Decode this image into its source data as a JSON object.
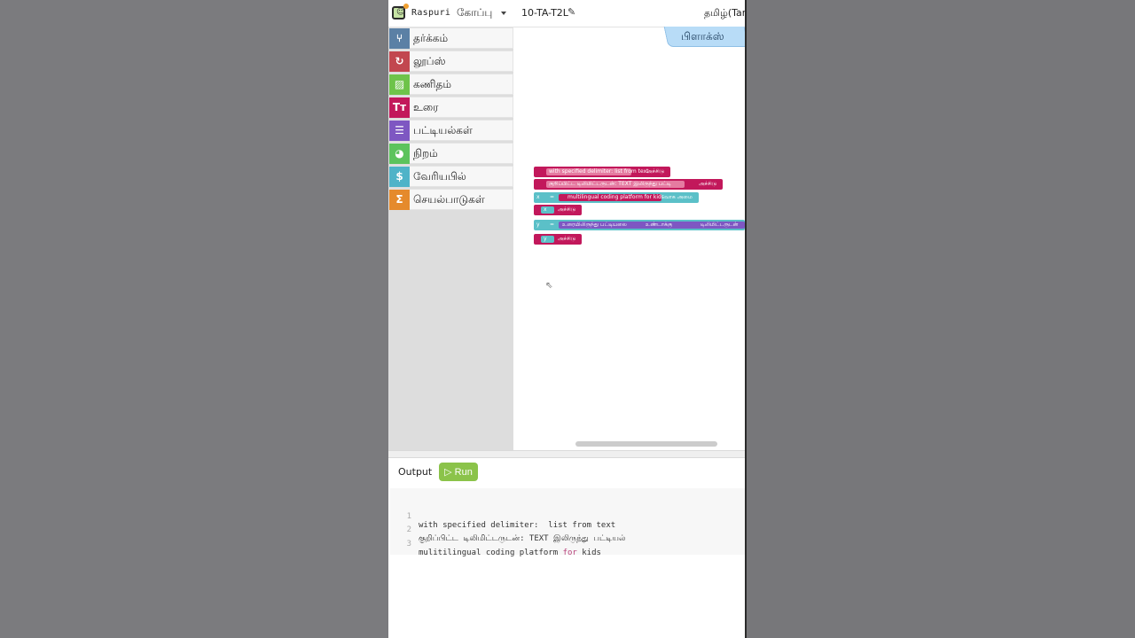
{
  "header": {
    "brand": "Raspuri",
    "menu_code": "கோப்பு",
    "project_name": "10-TA-T2L",
    "language": "தமிழ்(Tam"
  },
  "toolbox": {
    "categories": [
      {
        "label": "தர்க்கம்",
        "icon": "logic-icon",
        "color": "#5b80a5"
      },
      {
        "label": "லூப்ஸ்",
        "icon": "loop-icon",
        "color": "#c2474f"
      },
      {
        "label": "கணிதம்",
        "icon": "math-icon",
        "color": "#6ec34a"
      },
      {
        "label": "உரை",
        "icon": "text-icon",
        "color": "#c2185b"
      },
      {
        "label": "பட்டியல்கள்",
        "icon": "list-icon",
        "color": "#7e57c2"
      },
      {
        "label": "நிறம்",
        "icon": "palette-icon",
        "color": "#5cc35c"
      },
      {
        "label": "வேரியபில்",
        "icon": "variable-icon",
        "color": "#4fb3c8"
      },
      {
        "label": "செயல்பாடுகள்",
        "icon": "function-icon",
        "color": "#e58a2c"
      }
    ]
  },
  "workspace": {
    "flyout_label": "பிளாக்ஸ்",
    "blocks": {
      "b1_text": "with specified delimiter:  list from text",
      "b1_tail": "அச்சிடு",
      "b2_text": "குறிப்பிட்ட டிலிமிட்டருடன்: TEXT இலிருந்து பட்டி",
      "b2_tail": "அச்சிடு",
      "b3_var": "x",
      "b3_eq": "=",
      "b3_text": "multilingual coding platform for kids",
      "b3_tail": "வாக அமை",
      "b4_var": "x",
      "b4_tail": "அச்சிடு",
      "b5_var": "y",
      "b5_eq": "=",
      "b5_text": "உரையிலிருந்து பட்டியலை",
      "b5_mid": "உண்டாக்கு",
      "b5_tail": "டிலிமிட்டருடன்",
      "b6_var": "y",
      "b6_tail": "அச்சிடு"
    }
  },
  "output": {
    "label": "Output",
    "run_label": "▷ Run",
    "lines": [
      {
        "num": "1",
        "pre": "with specified delimiter:  list from text",
        "kw": "",
        "post": ""
      },
      {
        "num": "2",
        "pre": "குறிப்பிட்ட டிலிமிட்டருடன்: TEXT இலிருந்து பட்டியல்",
        "kw": "",
        "post": ""
      },
      {
        "num": "3",
        "pre": "mulitilingual coding platform ",
        "kw": "for",
        "post": " kids"
      }
    ]
  },
  "colors": {
    "text_block": "#c2185b",
    "variable_block": "#5bc0c8",
    "list_block": "#7e57c2",
    "run_button": "#8bc34a",
    "flyout_tab": "#b8dcf7"
  }
}
